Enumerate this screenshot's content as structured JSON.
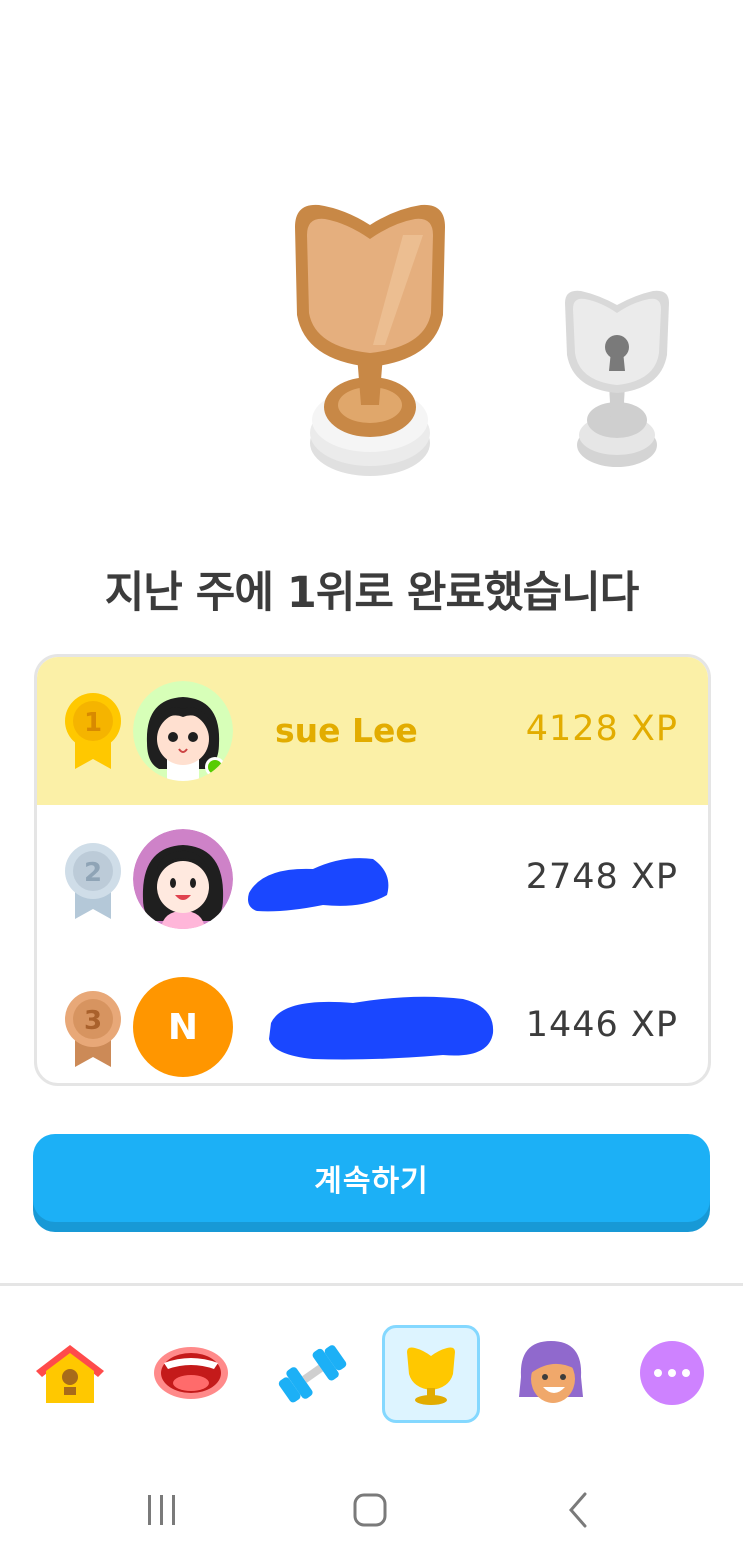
{
  "headline": "지난 주에 1위로 완료했습니다",
  "leaderboard": [
    {
      "rank": "1",
      "name": "sue Lee",
      "xp": "4128 XP",
      "online": true
    },
    {
      "rank": "2",
      "name": "",
      "xp": "2748 XP"
    },
    {
      "rank": "3",
      "name": "",
      "avatar_initial": "N",
      "xp": "1446 XP"
    }
  ],
  "continue_label": "계속하기",
  "tabs": [
    "home-icon",
    "speak-icon",
    "practice-icon",
    "leaderboard-icon",
    "profile-icon",
    "more-icon"
  ],
  "active_tab": "leaderboard-icon",
  "colors": {
    "accent": "#1cb0f6",
    "gold": "#e2ac00",
    "first_row_bg": "#fbf0a7",
    "redaction": "#1a47ff"
  }
}
